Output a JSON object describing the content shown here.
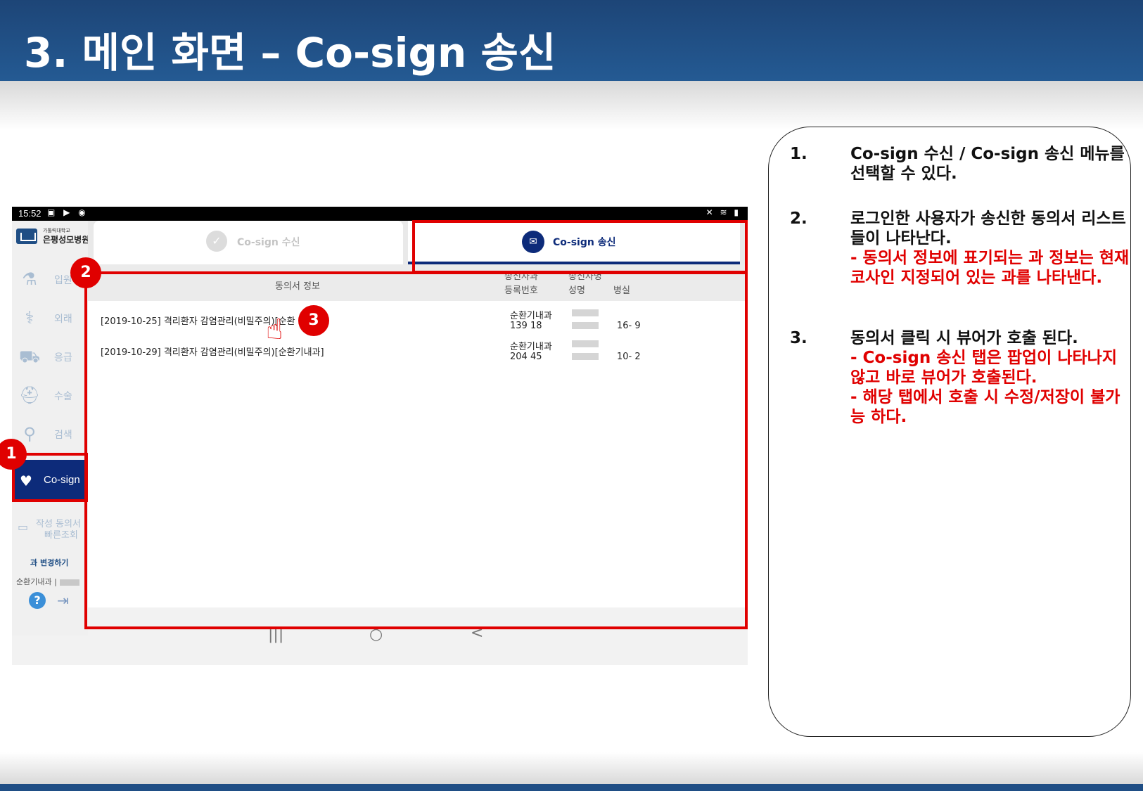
{
  "header": {
    "title": "3. 메인 화면 – Co-sign 송신"
  },
  "statusbar": {
    "time": "15:52",
    "left_icons": "▣ ▶ ◉",
    "right_icons": "✕ ≋ ▮"
  },
  "app": {
    "logo": {
      "small": "가톨릭대학교",
      "name": "은평성모병원"
    },
    "sidebar": {
      "items": [
        {
          "label": "입원",
          "icon": "iv-drip-icon"
        },
        {
          "label": "외래",
          "icon": "doctor-icon"
        },
        {
          "label": "응급",
          "icon": "ambulance-icon"
        },
        {
          "label": "수술",
          "icon": "surgery-bed-icon"
        },
        {
          "label": "검색",
          "icon": "search-person-icon"
        }
      ],
      "active": {
        "label": "Co-sign",
        "icon": "stethoscope-heart-icon"
      },
      "quick_line1": "작성 동의서",
      "quick_line2": "빠른조회",
      "change_dept": "과 변경하기",
      "dept": "순환기내과 |",
      "help": "?",
      "logout": "⇥"
    },
    "tabs": [
      {
        "label": "Co-sign 수신",
        "icon": "check-circle-icon"
      },
      {
        "label": "Co-sign 송신",
        "icon": "send-circle-icon"
      }
    ],
    "table": {
      "headers": {
        "info": "동의서 정보",
        "dept": "송신자과",
        "reg": "등록번호",
        "sender": "송신자명",
        "name": "성명",
        "room": "병실"
      },
      "rows": [
        {
          "title": "[2019-10-25] 격리환자 감염관리(비밀주의)[순환",
          "dept": "순환기내과",
          "reg": "139  18",
          "room": "16-  9"
        },
        {
          "title": "[2019-10-29] 격리환자 감염관리(비밀주의)[순환기내과]",
          "dept": "순환기내과",
          "reg": "204  45",
          "room": "10-  2"
        }
      ]
    },
    "navbar": {
      "recent": "|||",
      "home": "○",
      "back": "<"
    }
  },
  "badges": [
    "1",
    "2",
    "3"
  ],
  "panel": {
    "items": [
      {
        "num": "1.",
        "text": "Co-sign 수신 / Co-sign 송신 메뉴를 선택할 수 있다.",
        "notes": []
      },
      {
        "num": "2.",
        "text": "로그인한 사용자가 송신한 동의서 리스트들이 나타난다.",
        "notes": [
          "- 동의서 정보에 표기되는 과 정보는 현재 코사인 지정되어 있는 과를 나타낸다."
        ]
      },
      {
        "num": "3.",
        "text": "동의서 클릭 시 뷰어가 호출 된다.",
        "notes": [
          "- Co-sign 송신 탭은 팝업이 나타나지 않고 바로 뷰어가 호출된다.",
          "- 해당 탭에서 호출 시 수정/저장이 불가능 하다."
        ]
      }
    ]
  },
  "colors": {
    "header": "#245a93",
    "accent": "#0d2b7a",
    "annotation": "#e00000"
  }
}
